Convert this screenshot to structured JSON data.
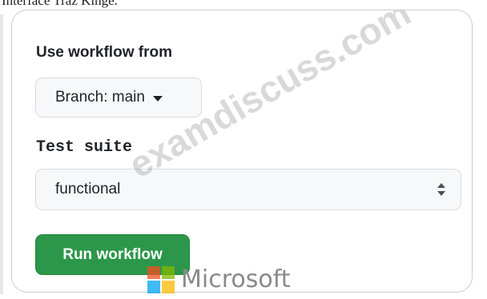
{
  "header_fragment": "Interface Traz Kinge.",
  "workflow_label": "Use workflow from",
  "branch_button": "Branch: main",
  "test_suite_label": "Test suite",
  "test_suite_value": "functional",
  "run_button": "Run workflow",
  "watermark": "examdiscuss.com",
  "logo_text": "Microsoft",
  "colors": {
    "run_button": "#2c974b",
    "text": "#1f2328",
    "field_bg": "#f6f8fa",
    "border": "#d8dce0"
  },
  "icons": {
    "branch_dropdown": "caret-down-icon",
    "select_arrows": "up-down-arrows-icon",
    "logo": "microsoft-logo-icon"
  }
}
